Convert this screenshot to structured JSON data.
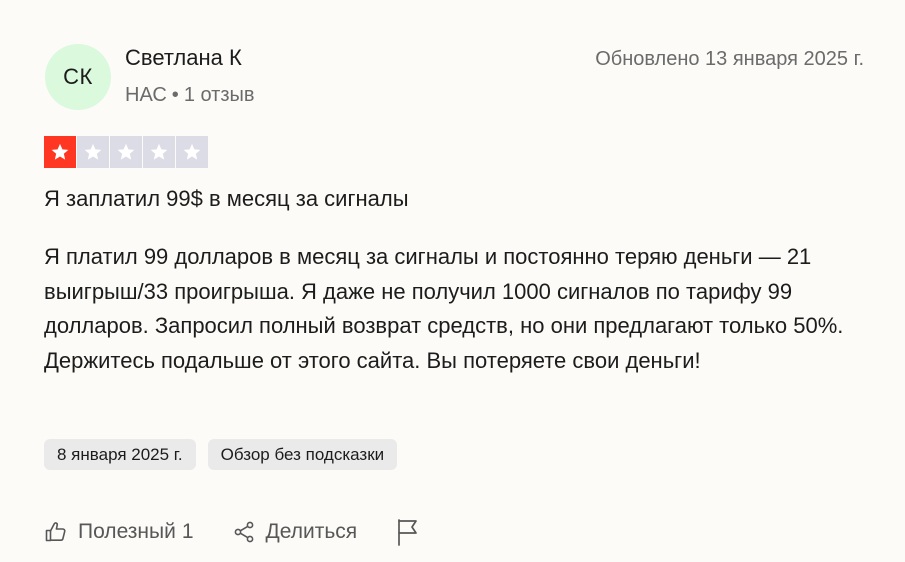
{
  "reviewer": {
    "initials": "СК",
    "name": "Светлана К",
    "country": "НАС",
    "separator": "•",
    "reviews_count": "1 отзыв"
  },
  "updated_label": "Обновлено 13 января 2025 г.",
  "rating": {
    "value": 1,
    "max": 5,
    "filled_color": "#ff3722",
    "empty_color": "#dcdce6"
  },
  "review": {
    "title": "Я заплатил 99$ в месяц за сигналы",
    "body": "Я платил 99 долларов в месяц за сигналы и постоянно теряю деньги — 21 выигрыш/33 проигрыша. Я даже не получил 1000 сигналов по тарифу 99 долларов. Запросил полный возврат средств, но они предлагают только 50%. Держитесь подальше от этого сайта. Вы потеряете свои деньги!"
  },
  "tags": {
    "date": "8 января 2025 г.",
    "unprompted": "Обзор без подсказки"
  },
  "actions": {
    "useful_label": "Полезный",
    "useful_count": "1",
    "share_label": "Делиться",
    "icons": [
      "thumbs-up-icon",
      "share-icon",
      "flag-icon"
    ]
  },
  "colors": {
    "background": "#fcfbf8",
    "avatar_bg": "#daf9dd",
    "tag_bg": "#eaeaea",
    "muted_text": "#6b6b6b"
  }
}
